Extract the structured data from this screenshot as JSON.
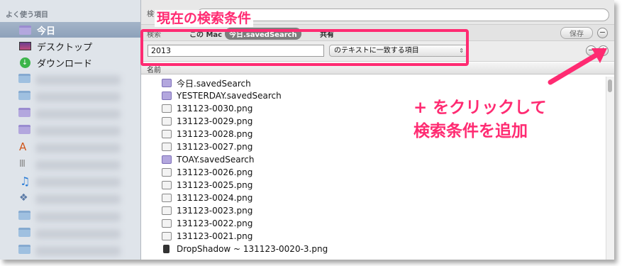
{
  "sidebar": {
    "header": "よく使う項目",
    "items": [
      {
        "label": "今日",
        "icon": "saved-search-icon",
        "selected": true
      },
      {
        "label": "デスクトップ",
        "icon": "desktop-icon",
        "selected": false
      },
      {
        "label": "ダウンロード",
        "icon": "download-icon",
        "selected": false
      }
    ],
    "hidden_items_icons": [
      "folder-icon",
      "folder-icon",
      "saved-search-icon",
      "saved-search-icon",
      "applications-icon",
      "library-icon",
      "music-icon",
      "dropbox-icon",
      "folder-icon",
      "folder-icon",
      "folder-icon"
    ]
  },
  "search": {
    "label": "検索対象：",
    "scope_label": "検索",
    "scope_this_mac": "この Mac",
    "scope_saved": "今日.savedSearch",
    "scope_shared": "共有",
    "save_button": "保存",
    "remove_button": "−"
  },
  "criteria": {
    "value": "2013",
    "condition": "のテキストに一致する項目",
    "minus": "−",
    "plus": "+"
  },
  "column_header": "名前",
  "files": [
    {
      "name": "今日.savedSearch",
      "type": "saved"
    },
    {
      "name": "YESTERDAY.savedSearch",
      "type": "saved"
    },
    {
      "name": "131123-0030.png",
      "type": "png"
    },
    {
      "name": "131123-0029.png",
      "type": "png"
    },
    {
      "name": "131123-0028.png",
      "type": "png"
    },
    {
      "name": "131123-0027.png",
      "type": "png"
    },
    {
      "name": "TOAY.savedSearch",
      "type": "saved"
    },
    {
      "name": "131123-0026.png",
      "type": "png"
    },
    {
      "name": "131123-0025.png",
      "type": "png"
    },
    {
      "name": "131123-0024.png",
      "type": "png"
    },
    {
      "name": "131123-0023.png",
      "type": "png"
    },
    {
      "name": "131123-0022.png",
      "type": "png"
    },
    {
      "name": "131123-0021.png",
      "type": "png"
    },
    {
      "name": "DropShadow ~ 131123-0020-3.png",
      "type": "drop"
    }
  ],
  "annotation": {
    "title": "現在の検索条件",
    "note_line1": "+ をクリックして",
    "note_line2": "検索条件を追加",
    "color": "#ff2b72"
  }
}
